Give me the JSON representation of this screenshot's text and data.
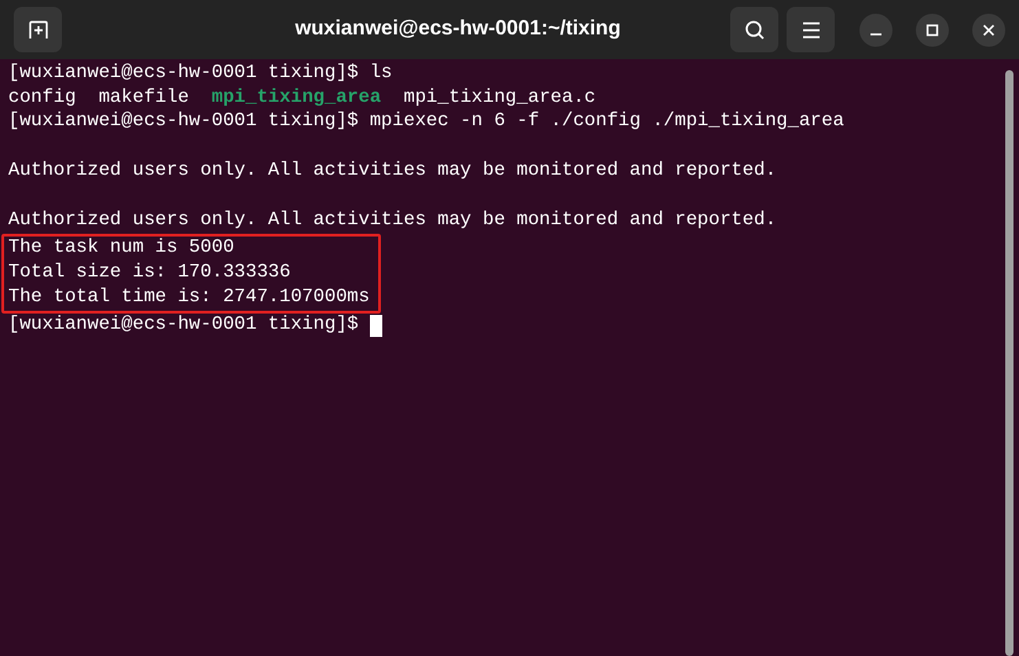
{
  "window": {
    "title": "wuxianwei@ecs-hw-0001:~/tixing"
  },
  "terminal": {
    "lines": [
      {
        "kind": "text",
        "highlighted": false,
        "cursor": false,
        "segments": [
          {
            "text": "[wuxianwei@ecs-hw-0001 tixing]$ ls",
            "kind": "plain"
          }
        ]
      },
      {
        "kind": "text",
        "highlighted": false,
        "cursor": false,
        "segments": [
          {
            "text": "config  makefile  ",
            "kind": "plain"
          },
          {
            "text": "mpi_tixing_area",
            "kind": "executable"
          },
          {
            "text": "  mpi_tixing_area.c",
            "kind": "plain"
          }
        ]
      },
      {
        "kind": "text",
        "highlighted": false,
        "cursor": false,
        "segments": [
          {
            "text": "[wuxianwei@ecs-hw-0001 tixing]$ mpiexec -n 6 -f ./config ./mpi_tixing_area",
            "kind": "plain"
          }
        ]
      },
      {
        "kind": "blank"
      },
      {
        "kind": "text",
        "highlighted": false,
        "cursor": false,
        "segments": [
          {
            "text": "Authorized users only. All activities may be monitored and reported.",
            "kind": "plain"
          }
        ]
      },
      {
        "kind": "blank"
      },
      {
        "kind": "text",
        "highlighted": false,
        "cursor": false,
        "segments": [
          {
            "text": "Authorized users only. All activities may be monitored and reported.",
            "kind": "plain"
          }
        ]
      },
      {
        "kind": "text",
        "highlighted": true,
        "cursor": false,
        "segments": [
          {
            "text": "The task num is 5000",
            "kind": "plain"
          }
        ]
      },
      {
        "kind": "text",
        "highlighted": true,
        "cursor": false,
        "segments": [
          {
            "text": "Total size is: 170.333336",
            "kind": "plain"
          }
        ]
      },
      {
        "kind": "text",
        "highlighted": true,
        "cursor": false,
        "segments": [
          {
            "text": "The total time is: 2747.107000ms",
            "kind": "plain"
          }
        ]
      },
      {
        "kind": "text",
        "highlighted": false,
        "cursor": true,
        "segments": [
          {
            "text": "[wuxianwei@ecs-hw-0001 tixing]$ ",
            "kind": "plain"
          }
        ]
      }
    ]
  }
}
